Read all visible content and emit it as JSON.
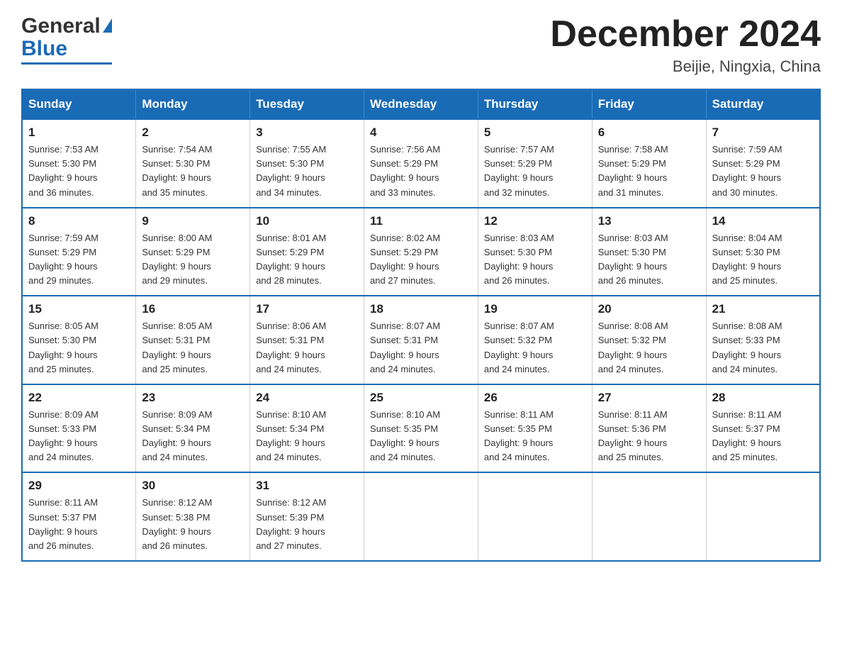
{
  "header": {
    "title": "December 2024",
    "subtitle": "Beijie, Ningxia, China",
    "logo_general": "General",
    "logo_blue": "Blue"
  },
  "columns": [
    "Sunday",
    "Monday",
    "Tuesday",
    "Wednesday",
    "Thursday",
    "Friday",
    "Saturday"
  ],
  "weeks": [
    [
      {
        "day": "1",
        "sunrise": "7:53 AM",
        "sunset": "5:30 PM",
        "daylight": "9 hours and 36 minutes."
      },
      {
        "day": "2",
        "sunrise": "7:54 AM",
        "sunset": "5:30 PM",
        "daylight": "9 hours and 35 minutes."
      },
      {
        "day": "3",
        "sunrise": "7:55 AM",
        "sunset": "5:30 PM",
        "daylight": "9 hours and 34 minutes."
      },
      {
        "day": "4",
        "sunrise": "7:56 AM",
        "sunset": "5:29 PM",
        "daylight": "9 hours and 33 minutes."
      },
      {
        "day": "5",
        "sunrise": "7:57 AM",
        "sunset": "5:29 PM",
        "daylight": "9 hours and 32 minutes."
      },
      {
        "day": "6",
        "sunrise": "7:58 AM",
        "sunset": "5:29 PM",
        "daylight": "9 hours and 31 minutes."
      },
      {
        "day": "7",
        "sunrise": "7:59 AM",
        "sunset": "5:29 PM",
        "daylight": "9 hours and 30 minutes."
      }
    ],
    [
      {
        "day": "8",
        "sunrise": "7:59 AM",
        "sunset": "5:29 PM",
        "daylight": "9 hours and 29 minutes."
      },
      {
        "day": "9",
        "sunrise": "8:00 AM",
        "sunset": "5:29 PM",
        "daylight": "9 hours and 29 minutes."
      },
      {
        "day": "10",
        "sunrise": "8:01 AM",
        "sunset": "5:29 PM",
        "daylight": "9 hours and 28 minutes."
      },
      {
        "day": "11",
        "sunrise": "8:02 AM",
        "sunset": "5:29 PM",
        "daylight": "9 hours and 27 minutes."
      },
      {
        "day": "12",
        "sunrise": "8:03 AM",
        "sunset": "5:30 PM",
        "daylight": "9 hours and 26 minutes."
      },
      {
        "day": "13",
        "sunrise": "8:03 AM",
        "sunset": "5:30 PM",
        "daylight": "9 hours and 26 minutes."
      },
      {
        "day": "14",
        "sunrise": "8:04 AM",
        "sunset": "5:30 PM",
        "daylight": "9 hours and 25 minutes."
      }
    ],
    [
      {
        "day": "15",
        "sunrise": "8:05 AM",
        "sunset": "5:30 PM",
        "daylight": "9 hours and 25 minutes."
      },
      {
        "day": "16",
        "sunrise": "8:05 AM",
        "sunset": "5:31 PM",
        "daylight": "9 hours and 25 minutes."
      },
      {
        "day": "17",
        "sunrise": "8:06 AM",
        "sunset": "5:31 PM",
        "daylight": "9 hours and 24 minutes."
      },
      {
        "day": "18",
        "sunrise": "8:07 AM",
        "sunset": "5:31 PM",
        "daylight": "9 hours and 24 minutes."
      },
      {
        "day": "19",
        "sunrise": "8:07 AM",
        "sunset": "5:32 PM",
        "daylight": "9 hours and 24 minutes."
      },
      {
        "day": "20",
        "sunrise": "8:08 AM",
        "sunset": "5:32 PM",
        "daylight": "9 hours and 24 minutes."
      },
      {
        "day": "21",
        "sunrise": "8:08 AM",
        "sunset": "5:33 PM",
        "daylight": "9 hours and 24 minutes."
      }
    ],
    [
      {
        "day": "22",
        "sunrise": "8:09 AM",
        "sunset": "5:33 PM",
        "daylight": "9 hours and 24 minutes."
      },
      {
        "day": "23",
        "sunrise": "8:09 AM",
        "sunset": "5:34 PM",
        "daylight": "9 hours and 24 minutes."
      },
      {
        "day": "24",
        "sunrise": "8:10 AM",
        "sunset": "5:34 PM",
        "daylight": "9 hours and 24 minutes."
      },
      {
        "day": "25",
        "sunrise": "8:10 AM",
        "sunset": "5:35 PM",
        "daylight": "9 hours and 24 minutes."
      },
      {
        "day": "26",
        "sunrise": "8:11 AM",
        "sunset": "5:35 PM",
        "daylight": "9 hours and 24 minutes."
      },
      {
        "day": "27",
        "sunrise": "8:11 AM",
        "sunset": "5:36 PM",
        "daylight": "9 hours and 25 minutes."
      },
      {
        "day": "28",
        "sunrise": "8:11 AM",
        "sunset": "5:37 PM",
        "daylight": "9 hours and 25 minutes."
      }
    ],
    [
      {
        "day": "29",
        "sunrise": "8:11 AM",
        "sunset": "5:37 PM",
        "daylight": "9 hours and 26 minutes."
      },
      {
        "day": "30",
        "sunrise": "8:12 AM",
        "sunset": "5:38 PM",
        "daylight": "9 hours and 26 minutes."
      },
      {
        "day": "31",
        "sunrise": "8:12 AM",
        "sunset": "5:39 PM",
        "daylight": "9 hours and 27 minutes."
      },
      null,
      null,
      null,
      null
    ]
  ],
  "labels": {
    "sunrise_prefix": "Sunrise: ",
    "sunset_prefix": "Sunset: ",
    "daylight_prefix": "Daylight: "
  }
}
